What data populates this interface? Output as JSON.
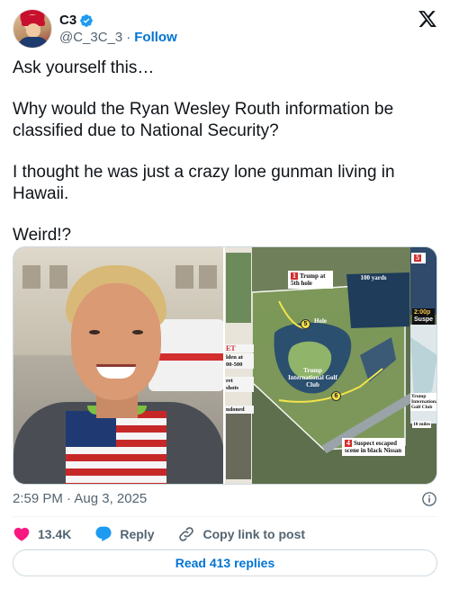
{
  "author": {
    "display_name": "C3",
    "handle": "@C_3C_3",
    "separator": "·",
    "follow_label": "Follow"
  },
  "tweet": {
    "paragraphs": [
      "Ask yourself this…",
      "Why would the Ryan Wesley Routh information be classified due to National Security?",
      "I thought he was just a crazy lone gunman living in Hawaii.",
      "Weird!?"
    ],
    "timestamp": "2:59 PM · Aug 3, 2025"
  },
  "map": {
    "label_1_num": "1",
    "label_1_text": "Trump at 5th hole",
    "label_yards": "100 yards",
    "label_hole": "Hole",
    "label_club": "Trump International Golf Club",
    "label_4_num": "4",
    "label_4_text": "Suspect escaped scene in black Nissan",
    "label_5_num": "5",
    "time_text": "2:00p",
    "time_sub": "Suspe",
    "inset_club": "Trump International Golf Club",
    "inset_miles": "10 miles",
    "strip_et": "ET",
    "strip_1": "lden at",
    "strip_2": "00-500",
    "strip_3": "ret",
    "strip_4": "shots",
    "strip_5": "ndoned",
    "marker_5": "5",
    "marker_6": "6"
  },
  "actions": {
    "like_count": "13.4K",
    "reply_label": "Reply",
    "copy_label": "Copy link to post"
  },
  "replies": {
    "read_label": "Read 413 replies"
  },
  "colors": {
    "accent": "#0074d3",
    "like": "#f91880",
    "verified": "#1d9bf0"
  }
}
